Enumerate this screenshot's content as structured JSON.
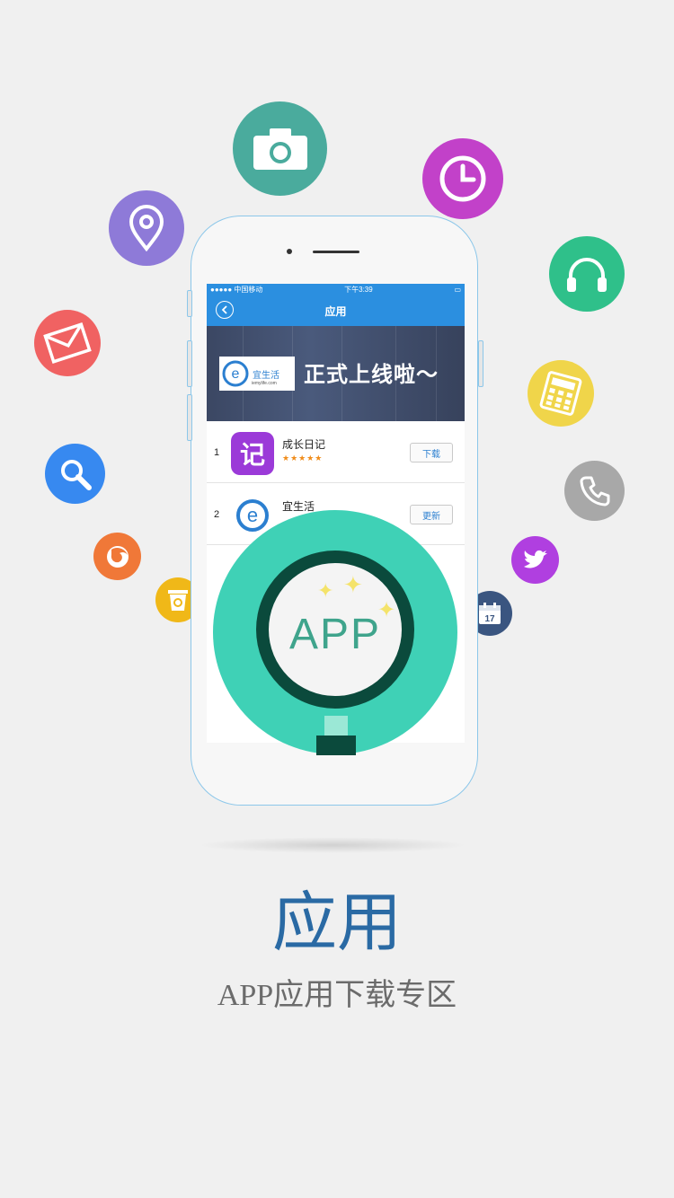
{
  "status_bar": {
    "carrier": "●●●●● 中国移动",
    "time": "下午3:39"
  },
  "nav": {
    "title": "应用"
  },
  "banner": {
    "brand": "宜生活",
    "url": "iemylife.com",
    "slogan": "正式上线啦～"
  },
  "apps": [
    {
      "rank": "1",
      "name": "成长日记",
      "stars": "★★★★★",
      "button": "下载",
      "icon_color": "#9b3ad8"
    },
    {
      "rank": "2",
      "name": "宜生活",
      "button": "更新",
      "icon_color": "#2b7fd0"
    }
  ],
  "magnifier": {
    "label": "APP"
  },
  "page": {
    "title": "应用",
    "subtitle": "APP应用下载专区"
  },
  "icons": [
    {
      "name": "camera-icon",
      "color": "#4aab9d"
    },
    {
      "name": "clock-icon",
      "color": "#c241c9"
    },
    {
      "name": "location-pin-icon",
      "color": "#8e7ad8"
    },
    {
      "name": "headset-icon",
      "color": "#2fc08a"
    },
    {
      "name": "mail-icon",
      "color": "#f06262"
    },
    {
      "name": "calculator-icon",
      "color": "#f0d54a"
    },
    {
      "name": "search-icon",
      "color": "#3789f0"
    },
    {
      "name": "phone-icon",
      "color": "#a8a8a8"
    },
    {
      "name": "firefox-icon",
      "color": "#f07838"
    },
    {
      "name": "twitter-icon",
      "color": "#b03fe0"
    },
    {
      "name": "recycle-bin-icon",
      "color": "#f0b818"
    },
    {
      "name": "calendar-icon",
      "color": "#3a5580",
      "text": "17"
    }
  ]
}
